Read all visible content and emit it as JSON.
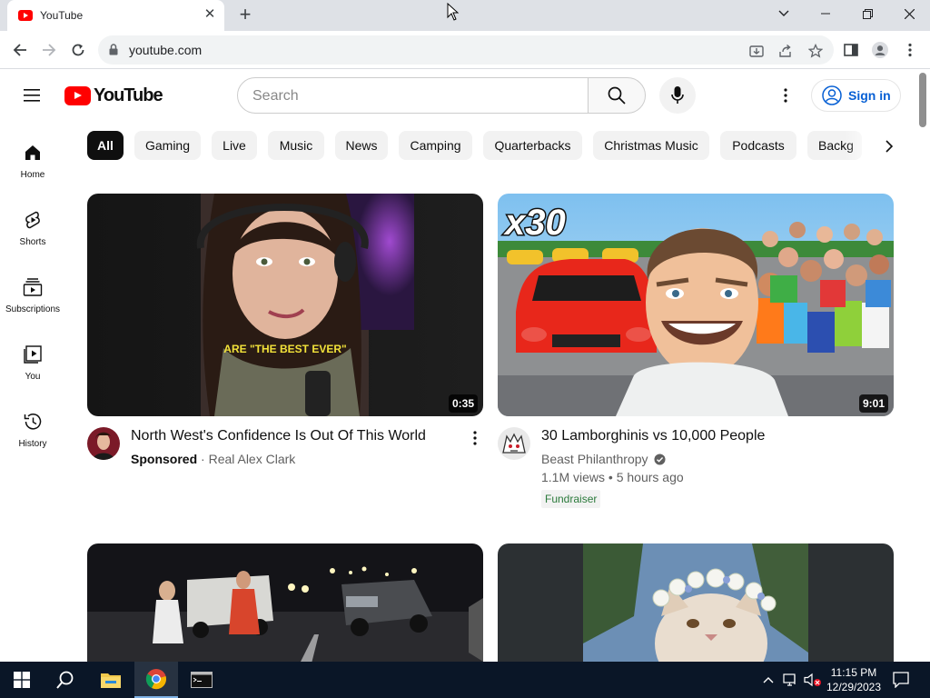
{
  "browser": {
    "tab_title": "YouTube",
    "url": "youtube.com"
  },
  "header": {
    "logo_text": "YouTube",
    "search_placeholder": "Search",
    "signin_label": "Sign in"
  },
  "sidebar": {
    "items": [
      {
        "label": "Home",
        "icon": "home-icon"
      },
      {
        "label": "Shorts",
        "icon": "shorts-icon"
      },
      {
        "label": "Subscriptions",
        "icon": "subscriptions-icon"
      },
      {
        "label": "You",
        "icon": "you-icon"
      },
      {
        "label": "History",
        "icon": "history-icon"
      }
    ]
  },
  "chips": [
    "All",
    "Gaming",
    "Live",
    "Music",
    "News",
    "Camping",
    "Quarterbacks",
    "Christmas Music",
    "Podcasts",
    "Backg"
  ],
  "videos": [
    {
      "title": "North West's Confidence Is Out Of This World",
      "sponsored": "Sponsored",
      "channel": "Real Alex Clark",
      "duration": "0:35",
      "caption_overlay": "ARE \"THE BEST EVER\""
    },
    {
      "title": "30 Lamborghinis vs 10,000 People",
      "channel": "Beast Philanthropy",
      "views": "1.1M views",
      "age": "5 hours ago",
      "badge": "Fundraiser",
      "duration": "9:01",
      "thumb_text": "x30"
    }
  ],
  "taskbar": {
    "time": "11:15 PM",
    "date": "12/29/2023"
  },
  "colors": {
    "youtube_red": "#ff0000",
    "link_blue": "#065fd4",
    "taskbar": "#0a1627"
  }
}
